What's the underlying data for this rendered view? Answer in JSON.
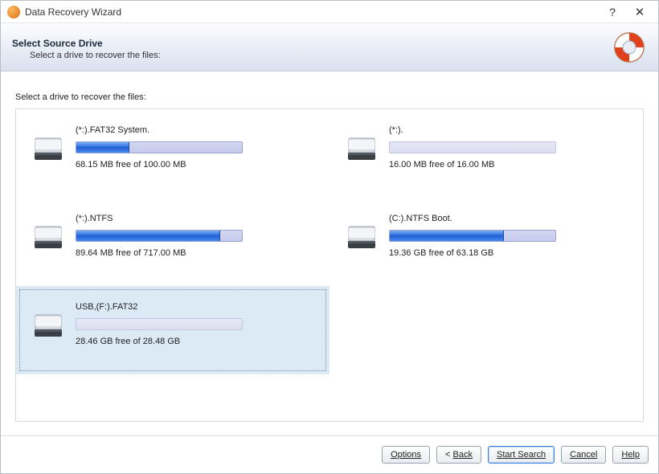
{
  "window": {
    "title": "Data Recovery Wizard",
    "help_glyph": "?",
    "close_glyph": "✕"
  },
  "header": {
    "title": "Select Source Drive",
    "subtitle": "Select a drive to recover the files:"
  },
  "instruction": "Select a drive to recover the files:",
  "drives": [
    {
      "name": "(*:).FAT32 System.",
      "free_text": "68.15 MB free of 100.00 MB",
      "used_pct": 32,
      "muted": false
    },
    {
      "name": "(*:).",
      "free_text": "16.00 MB free of 16.00 MB",
      "used_pct": 0,
      "muted": true
    },
    {
      "name": "(*:).NTFS",
      "free_text": "89.64 MB free of 717.00 MB",
      "used_pct": 87,
      "muted": false
    },
    {
      "name": "(C:).NTFS Boot.",
      "free_text": "19.36 GB free of 63.18 GB",
      "used_pct": 69,
      "muted": false
    },
    {
      "name": "USB,(F:).FAT32",
      "free_text": "28.46 GB free of 28.48 GB",
      "used_pct": 0,
      "muted": true
    }
  ],
  "selected_index": 4,
  "footer": {
    "options": "Options",
    "back": "Back",
    "back_arrow": "<",
    "start": "Start Search",
    "cancel": "Cancel",
    "help": "Help"
  }
}
